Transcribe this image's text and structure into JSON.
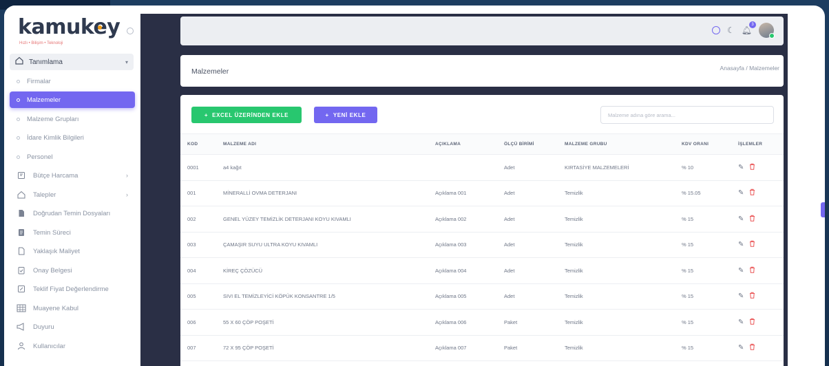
{
  "brand": {
    "name": "kamukey",
    "tagline": "Hızlı • Bilişim • Teknoloji"
  },
  "sidebar": {
    "group": {
      "label": "Tanımlama",
      "icon": "home-icon"
    },
    "subitems": [
      {
        "label": "Firmalar",
        "active": false
      },
      {
        "label": "Malzemeler",
        "active": true
      },
      {
        "label": "Malzeme Grupları",
        "active": false
      },
      {
        "label": "İdare Kimlik Bilgileri",
        "active": false
      },
      {
        "label": "Personel",
        "active": false
      }
    ],
    "items": [
      {
        "label": "Bütçe Harcama",
        "icon": "budget-icon",
        "chevron": true
      },
      {
        "label": "Talepler",
        "icon": "requests-icon",
        "chevron": true
      },
      {
        "label": "Doğrudan Temin Dosyaları",
        "icon": "file-icon",
        "chevron": false
      },
      {
        "label": "Temin Süreci",
        "icon": "document-icon",
        "chevron": false
      },
      {
        "label": "Yaklaşık Maliyet",
        "icon": "cost-icon",
        "chevron": false
      },
      {
        "label": "Onay Belgesi",
        "icon": "approval-icon",
        "chevron": false
      },
      {
        "label": "Teklif Fiyat Değerlendirme",
        "icon": "evaluate-icon",
        "chevron": false
      },
      {
        "label": "Muayene Kabul",
        "icon": "grid-icon",
        "chevron": false
      },
      {
        "label": "Duyuru",
        "icon": "megaphone-icon",
        "chevron": false
      },
      {
        "label": "Kullanıcılar",
        "icon": "user-icon",
        "chevron": false
      }
    ]
  },
  "topbar": {
    "notification_count": "3"
  },
  "page": {
    "title": "Malzemeler",
    "breadcrumb": "Anasayfa / Malzemeler"
  },
  "toolbar": {
    "excel_label": "EXCEL ÜZERİNDEN EKLE",
    "new_label": "YENİ EKLE",
    "search_placeholder": "Malzeme adına göre arama..."
  },
  "table": {
    "headers": [
      "KOD",
      "MALZEME ADI",
      "AÇIKLAMA",
      "ÖLÇÜ BİRİMİ",
      "MALZEME GRUBU",
      "KDV ORANI",
      "İŞLEMLER"
    ],
    "rows": [
      [
        "0001",
        "a4 kağıt",
        "",
        "Adet",
        "KIRTASİYE MALZEMELERİ",
        "% 10"
      ],
      [
        "001",
        "MİNERALLİ OVMA DETERJANI",
        "Açıklama 001",
        "Adet",
        "Temizlik",
        "% 15.05"
      ],
      [
        "002",
        "GENEL YÜZEY TEMİZLİK DETERJANI KOYU KIVAMLI",
        "Açıklama 002",
        "Adet",
        "Temizlik",
        "% 15"
      ],
      [
        "003",
        "ÇAMAŞIR SUYU ULTRA KOYU KIVAMLI",
        "Açıklama 003",
        "Adet",
        "Temizlik",
        "% 15"
      ],
      [
        "004",
        "KİREÇ ÇÖZÜCÜ",
        "Açıklama 004",
        "Adet",
        "Temizlik",
        "% 15"
      ],
      [
        "005",
        "SIVI EL TEMİZLEYİCİ KÖPÜK KONSANTRE 1/5",
        "Açıklama 005",
        "Adet",
        "Temizlik",
        "% 15"
      ],
      [
        "006",
        "55 X 60 ÇÖP POŞETİ",
        "Açıklama 006",
        "Paket",
        "Temizlik",
        "% 15"
      ],
      [
        "007",
        "72 X 95 ÇÖP POŞETİ",
        "Açıklama 007",
        "Paket",
        "Temizlik",
        "% 15"
      ]
    ]
  },
  "colors": {
    "accent": "#7367f0",
    "success": "#28c76f",
    "danger": "#ea5455",
    "main_bg": "#2a2f45"
  }
}
